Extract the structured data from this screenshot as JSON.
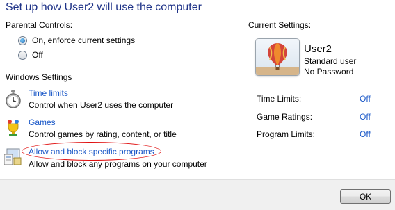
{
  "header": {
    "title": "Set up how User2 will use the computer"
  },
  "parental_controls": {
    "label": "Parental Controls:",
    "options": [
      {
        "label": "On, enforce current settings",
        "selected": true
      },
      {
        "label": "Off",
        "selected": false
      }
    ]
  },
  "windows_settings": {
    "label": "Windows Settings",
    "items": [
      {
        "link": "Time limits",
        "description": "Control when User2 uses the computer",
        "icon": "clock-icon"
      },
      {
        "link": "Games",
        "description": "Control games by rating, content, or title",
        "icon": "games-trophy-icon"
      },
      {
        "link": "Allow and block specific programs",
        "description": "Allow and block any programs on your computer",
        "icon": "programs-icon"
      }
    ]
  },
  "current_settings": {
    "label": "Current Settings:",
    "user": {
      "name": "User2",
      "account_type": "Standard user",
      "password_status": "No Password"
    },
    "rows": [
      {
        "label": "Time Limits:",
        "value": "Off"
      },
      {
        "label": "Game Ratings:",
        "value": "Off"
      },
      {
        "label": "Program Limits:",
        "value": "Off"
      }
    ]
  },
  "footer": {
    "ok_label": "OK"
  },
  "colors": {
    "title": "#1e3287",
    "link": "#1a58c8",
    "highlight_ellipse": "#e01010",
    "footer_bg": "#f0f0f0"
  }
}
